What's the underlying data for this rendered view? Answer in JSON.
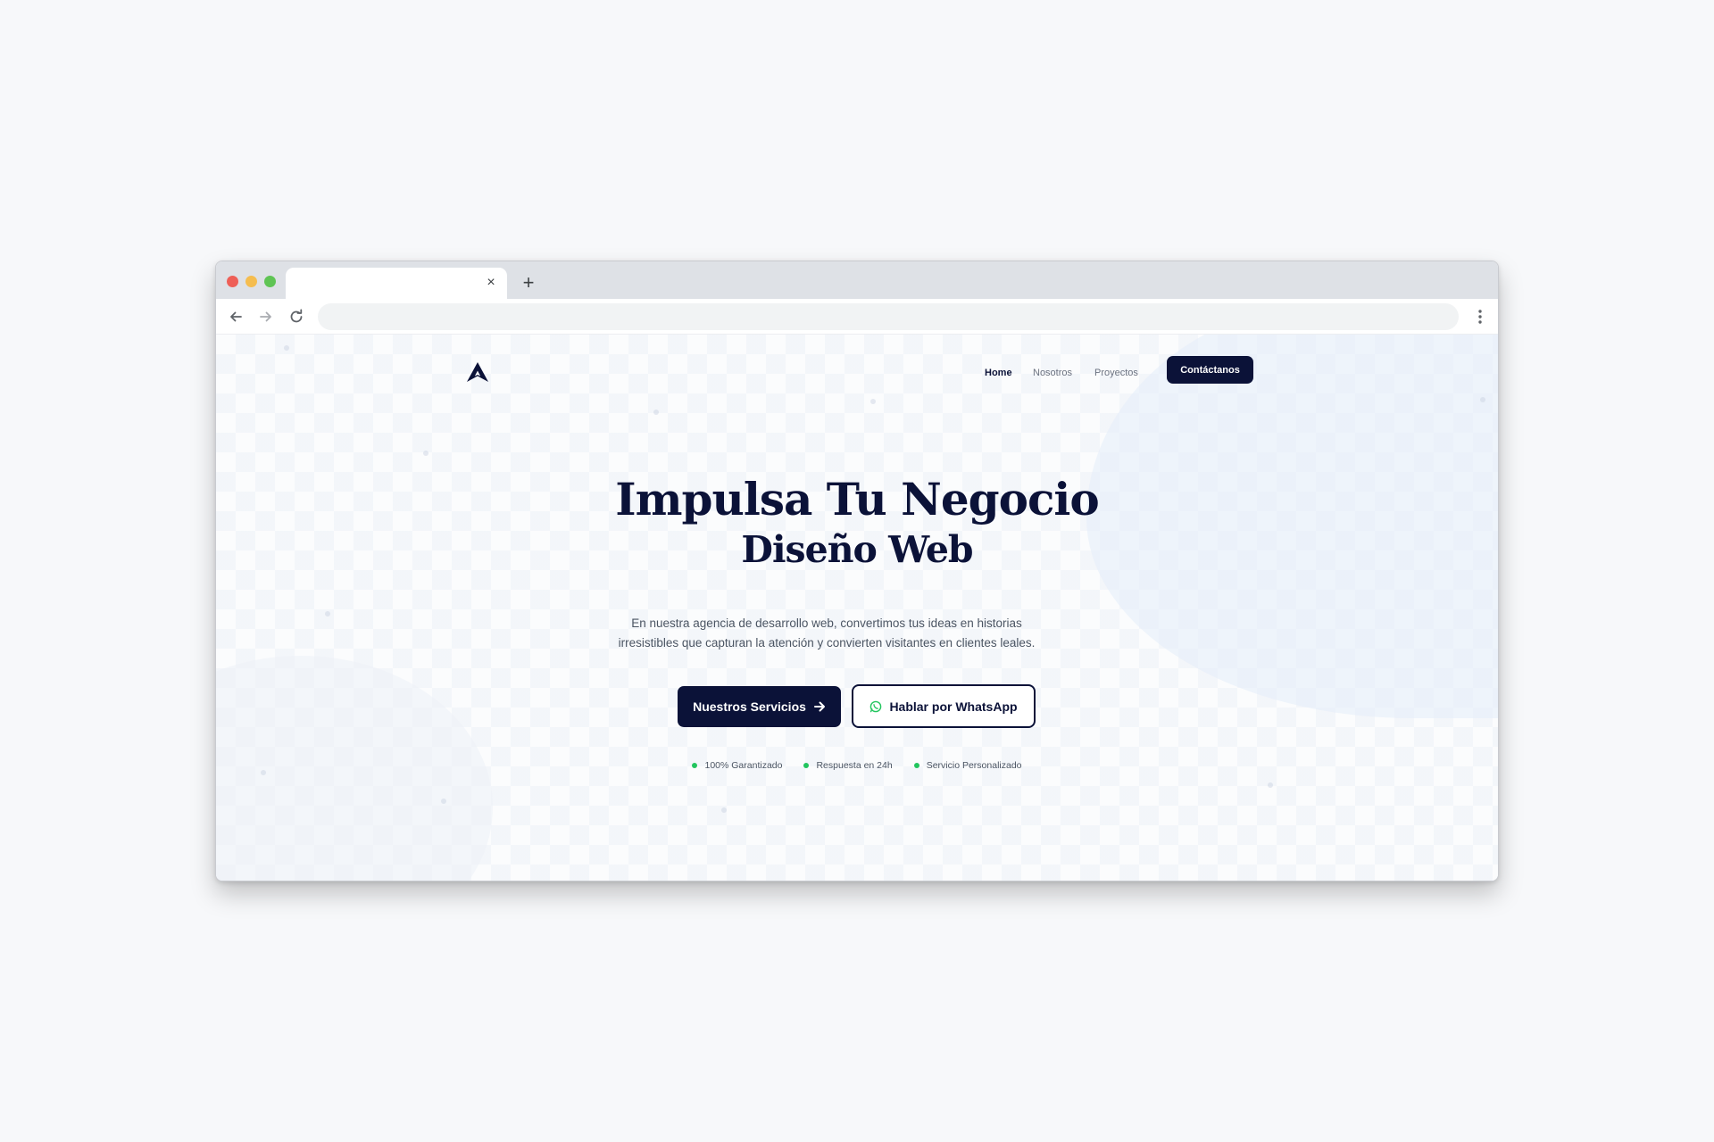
{
  "browser": {
    "tab_close_glyph": "×",
    "new_tab_glyph": "+",
    "address_value": "",
    "colors": {
      "close": "#ee5f57",
      "minimize": "#f5bd4f",
      "maximize": "#5fc454"
    }
  },
  "site": {
    "logo_icon": "triangle-a-logo-icon",
    "nav": {
      "home": "Home",
      "nosotros": "Nosotros",
      "proyectos": "Proyectos",
      "contact": "Contáctanos"
    },
    "hero": {
      "title": "Impulsa Tu Negocio",
      "subtitle": "Diseño Web",
      "description": "En nuestra agencia de desarrollo web, convertimos tus ideas en historias irresistibles que capturan la atención y convierten visitantes en clientes leales.",
      "primary_button": "Nuestros Servicios",
      "secondary_button": "Hablar por WhatsApp"
    },
    "badges": [
      {
        "label": "100% Garantizado"
      },
      {
        "label": "Respuesta en 24h"
      },
      {
        "label": "Servicio Personalizado"
      }
    ],
    "colors": {
      "brand": "#0b1238",
      "accent_green": "#22c55e",
      "text_muted": "#4b5563"
    }
  }
}
